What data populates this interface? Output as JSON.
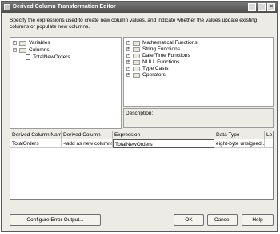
{
  "window": {
    "title": "Derived Column Transformation Editor",
    "controls": {
      "close": "×"
    }
  },
  "intro": "Specify the expressions used to create new column values, and indicate whether the values update existing columns or populate new columns.",
  "left_tree": {
    "items": [
      {
        "label": "Variables",
        "expander": "+"
      },
      {
        "label": "Columns",
        "expander": "−"
      },
      {
        "label": "TotalNewOrders"
      }
    ]
  },
  "right_tree": {
    "items": [
      {
        "label": "Mathematical Functions",
        "expander": "+"
      },
      {
        "label": "String Functions",
        "expander": "+"
      },
      {
        "label": "Date/Time Functions",
        "expander": "+"
      },
      {
        "label": "NULL Functions",
        "expander": "+"
      },
      {
        "label": "Type Casts",
        "expander": "+"
      },
      {
        "label": "Operators",
        "expander": "+"
      }
    ]
  },
  "description": {
    "label": "Description:"
  },
  "grid": {
    "headers": [
      "Derived Column Name",
      "Derived Column",
      "Expression",
      "Data Type",
      "Le"
    ],
    "rows": [
      [
        "TotalOrders",
        "<add as new column>",
        "TotalNewOrders",
        "eight-byte unsigned ...",
        ""
      ]
    ]
  },
  "buttons": {
    "configure": "Configure Error Output...",
    "ok": "OK",
    "cancel": "Cancel",
    "help": "Help"
  }
}
